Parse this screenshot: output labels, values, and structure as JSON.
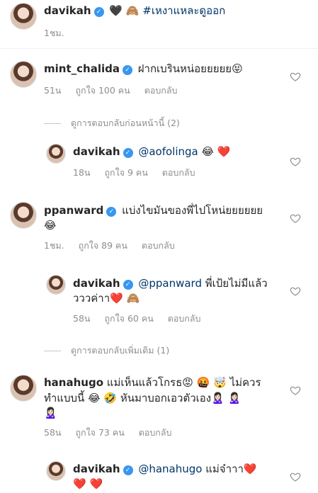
{
  "caption": {
    "username": "davikah",
    "emojis": "🖤 🙈",
    "hashtag": "#เหงาแหละดูออก",
    "time": "1ชม."
  },
  "comments": [
    {
      "username": "mint_chalida",
      "text": "ฝากเบรินหน่อยยยยย",
      "emoji_end": "😝",
      "time": "51น",
      "likes": "ถูกใจ 100 คน",
      "reply_label": "ตอบกลับ",
      "view_replies": "ดูการตอบกลับก่อนหน้านี้ (2)",
      "replies": [
        {
          "username": "davikah",
          "mention": "@aofolinga",
          "emoji": "😂 ❤️",
          "time": "18น",
          "likes": "ถูกใจ 9 คน",
          "reply_label": "ตอบกลับ"
        }
      ]
    },
    {
      "username": "ppanward",
      "text": "แบ่งไขมันของพี่ไปโหน่ยยยยยย",
      "line2": "😂",
      "time": "1ชม.",
      "likes": "ถูกใจ 89 คน",
      "reply_label": "ตอบกลับ",
      "replies": [
        {
          "username": "davikah",
          "mention": "@ppanward",
          "text": "พี่เป้ยไม่มีแล้ว",
          "line2": "วววค่าา",
          "emoji": "❤️ 🙈",
          "time": "58น",
          "likes": "ถูกใจ 60 คน",
          "reply_label": "ตอบกลับ"
        }
      ],
      "view_more": "ดูการตอบกลับเพิ่มเติม (1)"
    },
    {
      "username": "hanahugo",
      "text": "แม่เห็นแล้วโกรธ",
      "emojis1": "😡 🤬 🤯",
      "text_end": "ไม่ควร",
      "line2": "ทำแบบนี้",
      "emojis2": "😂 🤣",
      "line2_text": "หันมาบอกเอวตัวเอง",
      "emojis3": "🙎🏻‍♀️ 🙎🏻‍♀️",
      "line3": "🙎🏻‍♀️",
      "time": "58น",
      "likes": "ถูกใจ 73 คน",
      "reply_label": "ตอบกลับ",
      "replies": [
        {
          "username": "davikah",
          "mention": "@hanahugo",
          "text": "แม่จ๋าาา",
          "emoji": "❤️",
          "line2": "❤️ ❤️"
        }
      ]
    }
  ],
  "verified_mark": "✓"
}
